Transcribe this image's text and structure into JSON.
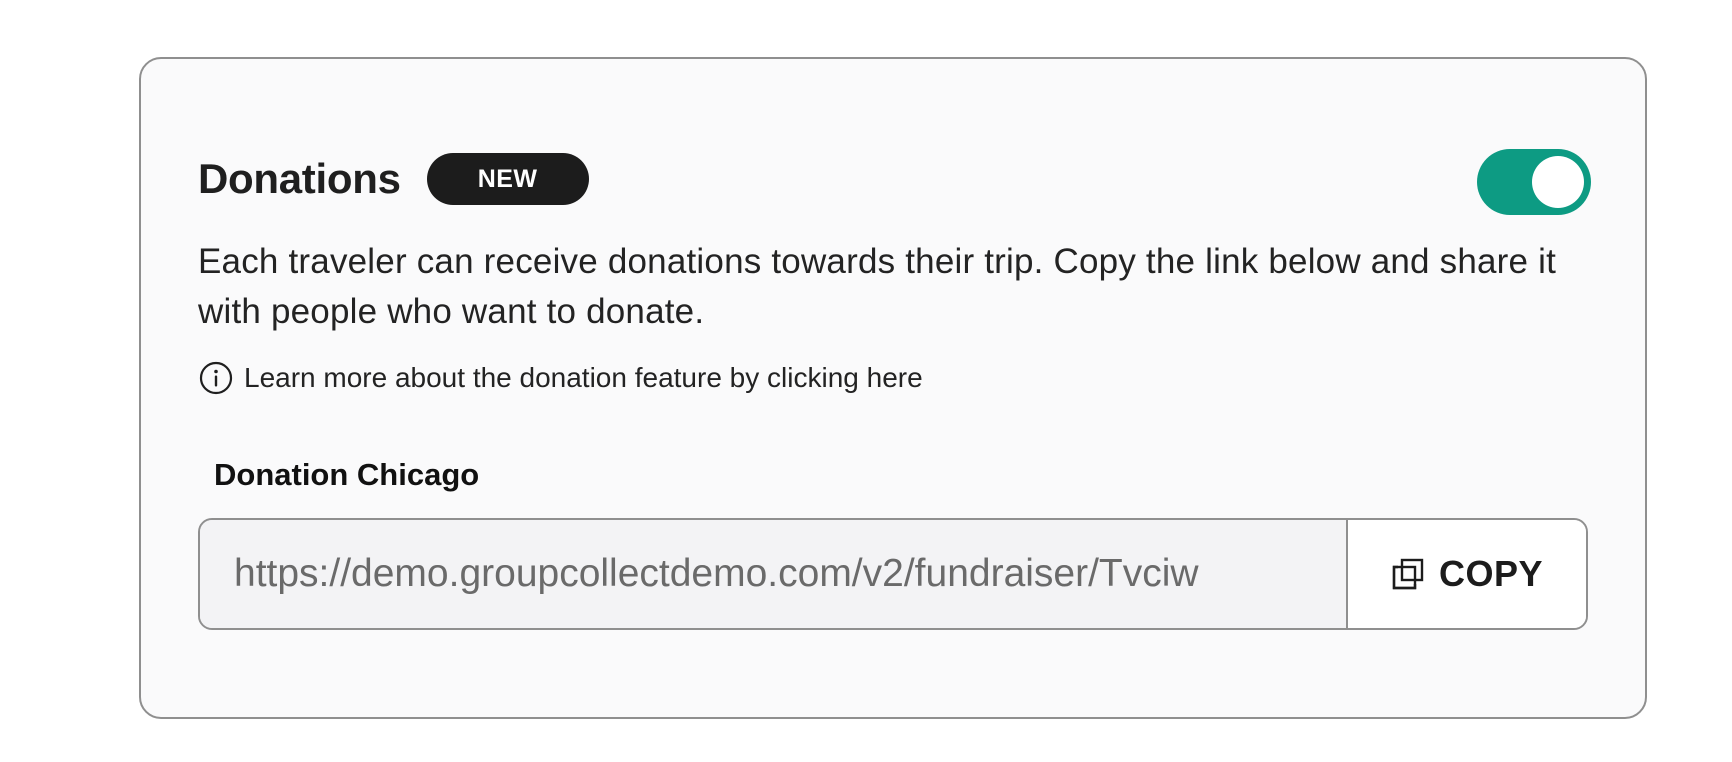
{
  "donations": {
    "title": "Donations",
    "badge": "NEW",
    "toggle_enabled": true,
    "accent_color": "#0d9b83",
    "description": "Each traveler can receive donations towards their trip. Copy the link below and share it with people who want to donate.",
    "learn_more": {
      "icon": "info-icon",
      "text": "Learn more about the donation feature by clicking here"
    },
    "link_field": {
      "label": "Donation Chicago",
      "value": "https://demo.groupcollectdemo.com/v2/fundraiser/Tvciw"
    },
    "copy_button": {
      "icon": "copy-icon",
      "label": "COPY"
    }
  }
}
